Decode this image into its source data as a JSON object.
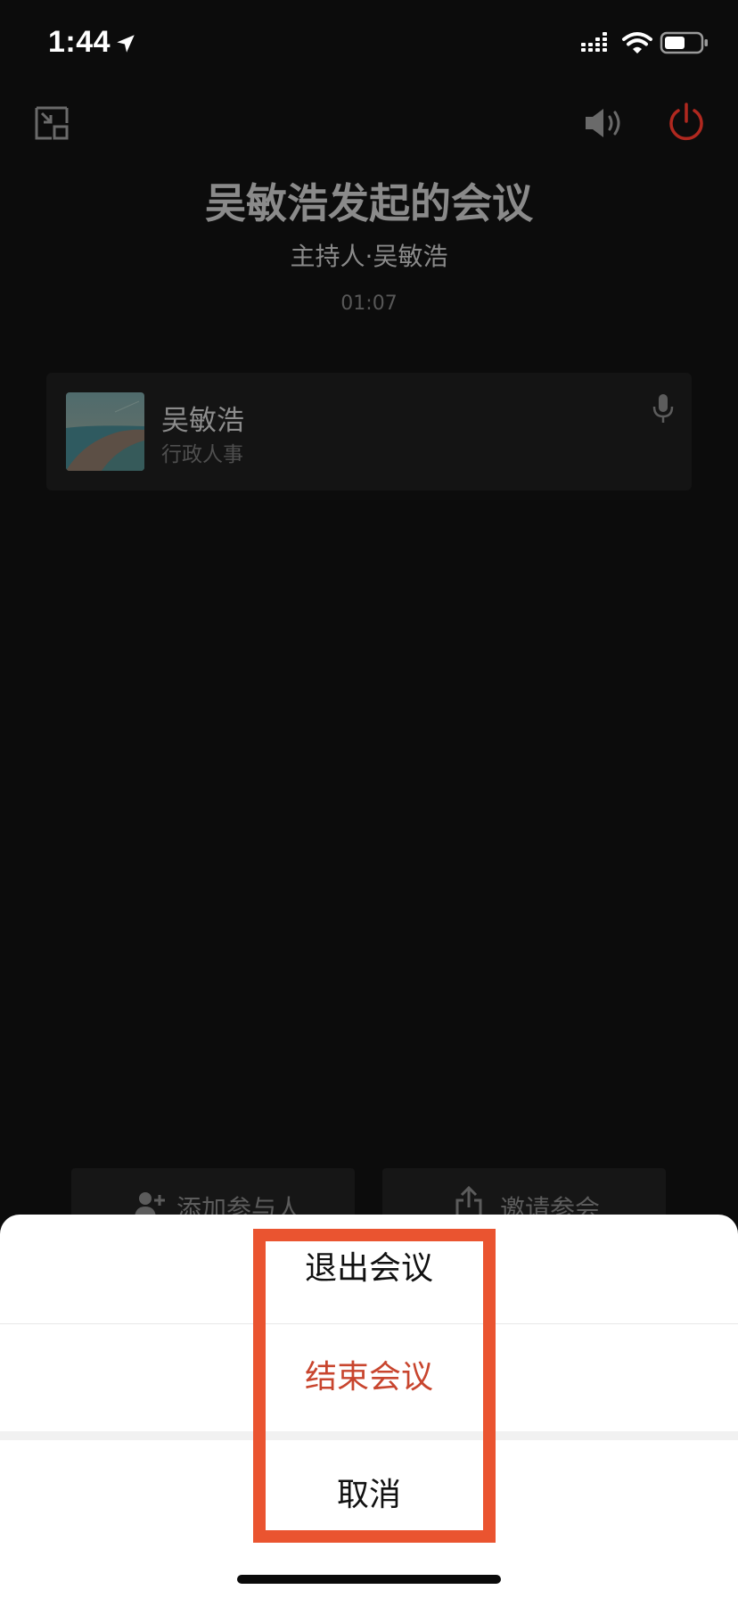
{
  "status_bar": {
    "time": "1:44",
    "icons": [
      "location-arrow-icon",
      "cellular-signal-icon",
      "wifi-icon",
      "battery-icon"
    ]
  },
  "header": {
    "left_icon": "minimize-window-icon",
    "right_icons": [
      "speaker-icon",
      "power-icon"
    ],
    "power_color": "#b0281f"
  },
  "meeting": {
    "title": "吴敏浩发起的会议",
    "host_line": "主持人·吴敏浩",
    "timer": "01:07"
  },
  "participants": [
    {
      "name": "吴敏浩",
      "department": "行政人事",
      "mic_icon": "microphone-icon"
    }
  ],
  "bottom_actions": {
    "add_label": "添加参与人",
    "invite_label": "邀请参会"
  },
  "action_sheet": {
    "leave_label": "退出会议",
    "end_label": "结束会议",
    "cancel_label": "取消",
    "end_color": "#c8452e",
    "highlight_color": "#ea5430"
  }
}
